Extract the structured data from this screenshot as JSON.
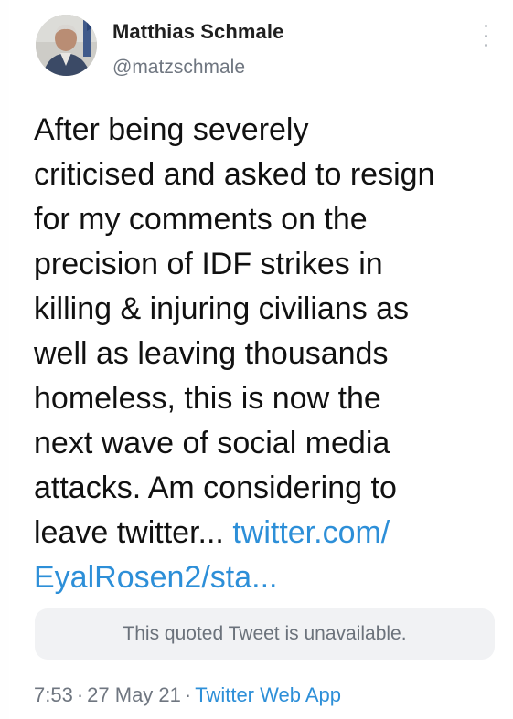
{
  "author": {
    "name": "Matthias Schmale",
    "handle": "@matzschmale"
  },
  "tweet": {
    "lines": [
      "After being severely",
      "criticised and asked to resign",
      "for my comments on the",
      "precision of IDF strikes in",
      "killing & injuring civilians as",
      "well as leaving thousands",
      "homeless, this is now the",
      "next wave of social media",
      "attacks. Am considering to"
    ],
    "line10_text": "leave twitter... ",
    "link_part1": "twitter.com/",
    "link_part2": "EyalRosen2/sta..."
  },
  "quote": {
    "message": "This quoted Tweet is unavailable."
  },
  "meta": {
    "time": "7:53",
    "separator": "·",
    "date": "27 May 21",
    "app": "Twitter Web App"
  },
  "icons": {
    "more": "more-vertical-icon",
    "avatar": "avatar"
  },
  "colors": {
    "link": "#2d8fd8",
    "text": "#111111",
    "secondary": "#6f7680",
    "quote_bg": "#f1f2f4"
  }
}
